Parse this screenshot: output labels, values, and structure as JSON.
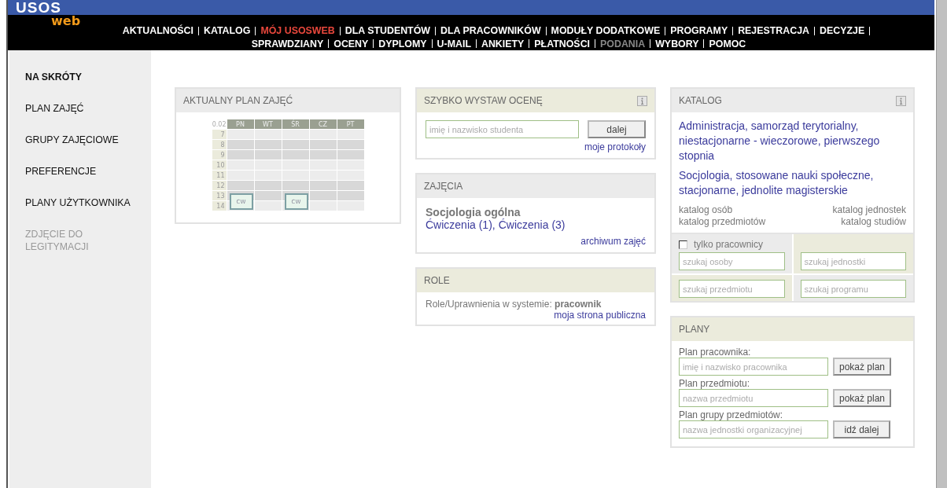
{
  "header": {
    "logo": "USOS",
    "logo_sub": "web",
    "menu_rows": [
      [
        {
          "label": "AKTUALNOŚCI",
          "selected": false,
          "disabled": false
        },
        {
          "label": "KATALOG",
          "selected": false,
          "disabled": false
        },
        {
          "label": "MÓJ USOSWEB",
          "selected": true,
          "disabled": false
        },
        {
          "label": "DLA STUDENTÓW",
          "selected": false,
          "disabled": false
        },
        {
          "label": "DLA PRACOWNIKÓW",
          "selected": false,
          "disabled": false
        },
        {
          "label": "MODUŁY DODATKOWE",
          "selected": false,
          "disabled": false
        },
        {
          "label": "PROGRAMY",
          "selected": false,
          "disabled": false
        },
        {
          "label": "REJESTRACJA",
          "selected": false,
          "disabled": false
        },
        {
          "label": "DECYZJE",
          "selected": false,
          "disabled": false
        }
      ],
      [
        {
          "label": "SPRAWDZIANY",
          "selected": false,
          "disabled": false
        },
        {
          "label": "OCENY",
          "selected": false,
          "disabled": false
        },
        {
          "label": "DYPLOMY",
          "selected": false,
          "disabled": false
        },
        {
          "label": "U-MAIL",
          "selected": false,
          "disabled": false
        },
        {
          "label": "ANKIETY",
          "selected": false,
          "disabled": false
        },
        {
          "label": "PŁATNOŚCI",
          "selected": false,
          "disabled": false
        },
        {
          "label": "PODANIA",
          "selected": false,
          "disabled": true
        },
        {
          "label": "WYBORY",
          "selected": false,
          "disabled": false
        },
        {
          "label": "POMOC",
          "selected": false,
          "disabled": false
        }
      ]
    ]
  },
  "sidebar": {
    "items": [
      {
        "label": "NA SKRÓTY",
        "selected": true,
        "disabled": false
      },
      {
        "label": "PLAN ZAJĘĆ",
        "selected": false,
        "disabled": false
      },
      {
        "label": "GRUPY ZAJĘCIOWE",
        "selected": false,
        "disabled": false
      },
      {
        "label": "PREFERENCJE",
        "selected": false,
        "disabled": false
      },
      {
        "label": "PLANY UŻYTKOWNIKA",
        "selected": false,
        "disabled": false
      },
      {
        "label": "ZDJĘCIE DO LEGITYMACJI",
        "selected": false,
        "disabled": true
      }
    ]
  },
  "schedule": {
    "title": "AKTUALNY PLAN ZAJĘĆ",
    "color": "#ebebeb",
    "corner": "0.02",
    "days": [
      "PN",
      "WT",
      "ŚR",
      "CZ",
      "PT"
    ],
    "hours": [
      "7",
      "8",
      "9",
      "10",
      "11",
      "12",
      "13",
      "14"
    ],
    "grid": [
      [
        {
          "kind": "empty"
        },
        {
          "kind": "empty"
        },
        {
          "kind": "empty"
        },
        {
          "kind": "empty"
        },
        {
          "kind": "empty"
        }
      ],
      [
        {
          "kind": "empty"
        },
        {
          "kind": "empty"
        },
        {
          "kind": "empty"
        },
        {
          "kind": "empty"
        },
        {
          "kind": "empty"
        }
      ],
      [
        {
          "kind": "empty"
        },
        {
          "kind": "empty"
        },
        {
          "kind": "empty"
        },
        {
          "kind": "empty"
        },
        {
          "kind": "empty"
        }
      ],
      [
        {
          "kind": "empty"
        },
        {
          "kind": "empty"
        },
        {
          "kind": "empty"
        },
        {
          "kind": "empty"
        },
        {
          "kind": "empty"
        }
      ],
      [
        {
          "kind": "empty"
        },
        {
          "kind": "empty"
        },
        {
          "kind": "empty"
        },
        {
          "kind": "empty"
        },
        {
          "kind": "empty"
        }
      ],
      [
        {
          "kind": "empty"
        },
        {
          "kind": "empty"
        },
        {
          "kind": "empty"
        },
        {
          "kind": "empty"
        },
        {
          "kind": "empty"
        }
      ],
      [
        {
          "kind": "class",
          "label": "CW"
        },
        {
          "kind": "empty"
        },
        {
          "kind": "class",
          "label": "CW"
        },
        {
          "kind": "empty"
        },
        {
          "kind": "empty"
        }
      ],
      [
        {
          "kind": "empty"
        },
        {
          "kind": "empty"
        },
        {
          "kind": "empty"
        },
        {
          "kind": "empty"
        },
        {
          "kind": "empty"
        }
      ]
    ]
  },
  "grade": {
    "title": "SZYBKO WYSTAW OCENĘ",
    "color": "#ebebdc",
    "placeholder": "imię i nazwisko studenta",
    "button": "dalej",
    "link": "moje protokoły"
  },
  "classes": {
    "title": "ZAJĘCIA",
    "color": "#ebebeb",
    "course": "Socjologia ogólna",
    "groups": [
      "Ćwiczenia (1)",
      "Ćwiczenia (3)"
    ],
    "separator": ",",
    "link": "archiwum zajęć"
  },
  "roles": {
    "title": "ROLE",
    "color": "#ebebdc",
    "text": "Role/Uprawnienia w systemie: **pracownik**",
    "link": "moja strona publiczna"
  },
  "catalog": {
    "title": "KATALOG",
    "color": "#ebebeb",
    "programmes": [
      "Administracja, samorząd terytorialny, niestacjonarne - wieczorowe, pierwszego stopnia",
      "Socjologia, stosowane nauki społeczne, stacjonarne, jednolite magisterskie"
    ],
    "links": [
      "katalog osób",
      "katalog jednostek",
      "katalog przedmiotów",
      "katalog studiów"
    ],
    "checkbox": {
      "label": "tylko pracownicy",
      "checked": false
    },
    "searches": [
      {
        "placeholder": "szukaj osoby"
      },
      {
        "placeholder": "szukaj jednostki"
      },
      {
        "placeholder": "szukaj przedmiotu"
      },
      {
        "placeholder": "szukaj programu"
      }
    ]
  },
  "plans": {
    "title": "PLANY",
    "color": "#ebebdc",
    "rows": [
      {
        "label": "Plan pracownika:",
        "placeholder": "imię i nazwisko pracownika",
        "button": "pokaż plan"
      },
      {
        "label": "Plan przedmiotu:",
        "placeholder": "nazwa przedmiotu",
        "button": "pokaż plan"
      },
      {
        "label": "Plan grupy przedmiotów:",
        "placeholder": "nazwa jednostki organizacyjnej",
        "button": "idź dalej"
      }
    ]
  }
}
